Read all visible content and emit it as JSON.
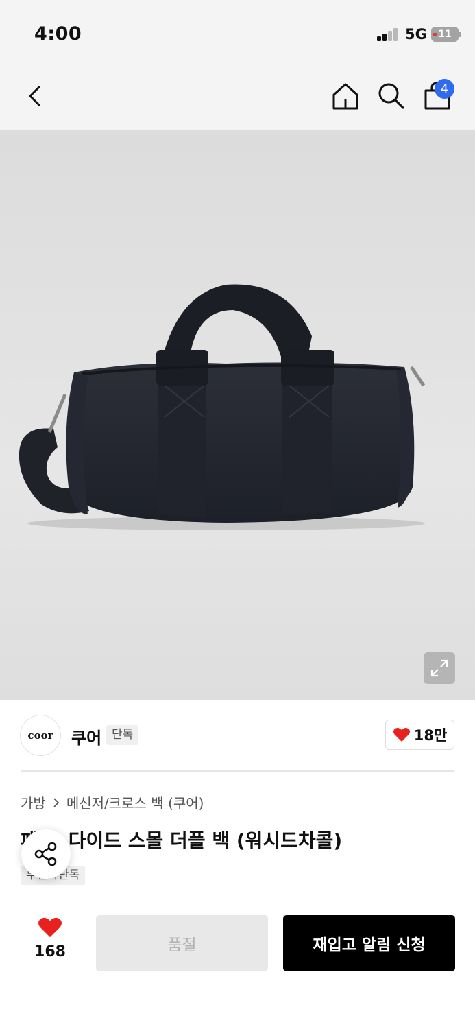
{
  "status_bar": {
    "time": "4:00",
    "network": "5G",
    "battery": "11"
  },
  "nav": {
    "back_icon": "chevron-left-icon",
    "home_icon": "home-icon",
    "search_icon": "search-icon",
    "cart_icon": "shopping-bag-icon",
    "cart_badge": "4",
    "badge_color": "#2f6bef"
  },
  "product_image": {
    "alt": "black canvas duffle bag",
    "expand_icon": "expand-icon"
  },
  "brand": {
    "logo_text": "coor",
    "name": "쿠어",
    "tag": "단독",
    "like_count": "18만",
    "like_icon": "heart-icon",
    "accent_color": "#e8201e"
  },
  "product": {
    "breadcrumb": [
      "가방",
      "메신저/크로스 백 (쿠어)"
    ],
    "title": "패디드 스몰 더플 백 (워시드차콜)",
    "title_visible": "다이드 스몰 더플 백 (워시드차콜)",
    "title_prefix_visible": "패",
    "badge": "무신사단독",
    "share_icon": "share-icon"
  },
  "bottom_bar": {
    "wish_count": "168",
    "soldout_label": "품절",
    "restock_label": "재입고 알림 신청"
  }
}
